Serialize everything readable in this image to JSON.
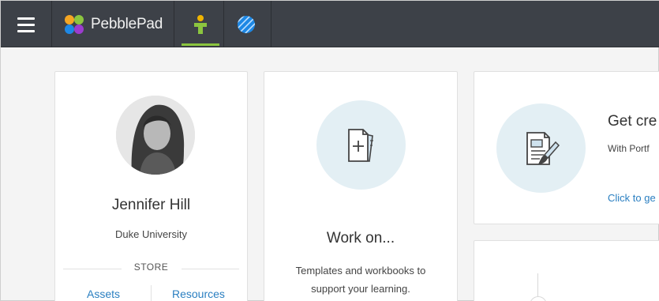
{
  "header": {
    "brand_name": "PebblePad",
    "colors": {
      "bar": "#3d4148",
      "active_tab": "#8bc53f"
    },
    "icons": [
      "menu-icon",
      "pebblepad-logo-icon",
      "person-icon",
      "globe-icon"
    ]
  },
  "profile": {
    "name": "Jennifer Hill",
    "institution": "Duke University",
    "store_label": "STORE",
    "links": [
      "Assets",
      "Resources"
    ]
  },
  "work_card": {
    "title": "Work on...",
    "description": "Templates and workbooks to support your learning."
  },
  "create_card": {
    "title": "Get cre",
    "subtitle": "With Portf",
    "link": "Click to ge"
  }
}
